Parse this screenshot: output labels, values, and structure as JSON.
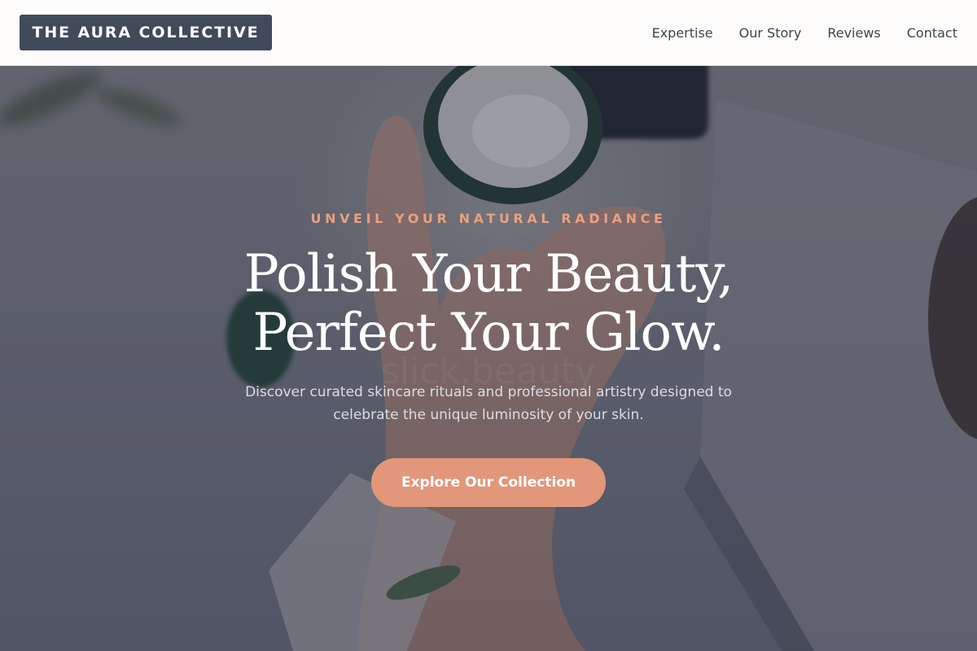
{
  "header": {
    "logo_text": "THE AURA COLLECTIVE",
    "nav": [
      {
        "label": "Expertise"
      },
      {
        "label": "Our Story"
      },
      {
        "label": "Reviews"
      },
      {
        "label": "Contact"
      }
    ]
  },
  "hero": {
    "eyebrow": "UNVEIL YOUR NATURAL RADIANCE",
    "headline_line1": "Polish Your Beauty,",
    "headline_line2": "Perfect Your Glow.",
    "subtext": "Discover curated skincare rituals and professional artistry designed to celebrate the unique luminosity of your skin.",
    "cta_label": "Explore Our Collection",
    "background_image": "hand-holding-cream-jar-photo"
  },
  "colors": {
    "header_bg": "#fdfcfb",
    "logo_bg": "#414a5b",
    "nav_text": "#3e4350",
    "eyebrow": "#e9a07f",
    "headline": "#ffffff",
    "subtext": "#dcdde2",
    "cta_bg": "#e3977a",
    "overlay": "#282e40"
  }
}
